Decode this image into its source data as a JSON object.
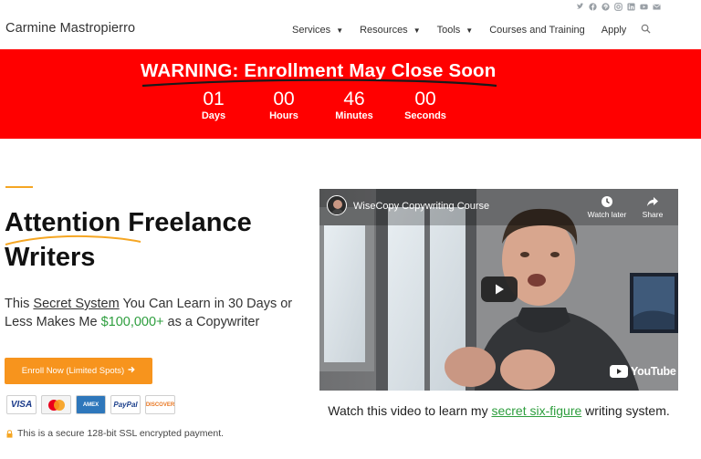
{
  "header": {
    "brand": "Carmine Mastropierro",
    "social_icons": [
      "twitter-icon",
      "facebook-icon",
      "pinterest-icon",
      "instagram-icon",
      "linkedin-icon",
      "youtube-icon",
      "email-icon"
    ],
    "nav": [
      {
        "label": "Services",
        "has_dropdown": true
      },
      {
        "label": "Resources",
        "has_dropdown": true
      },
      {
        "label": "Tools",
        "has_dropdown": true
      },
      {
        "label": "Courses and Training",
        "has_dropdown": false
      },
      {
        "label": "Apply",
        "has_dropdown": false
      }
    ]
  },
  "banner": {
    "title": "WARNING: Enrollment May Close Soon",
    "background": "#ff0000",
    "countdown": [
      {
        "value": "01",
        "label": "Days"
      },
      {
        "value": "00",
        "label": "Hours"
      },
      {
        "value": "46",
        "label": "Minutes"
      },
      {
        "value": "00",
        "label": "Seconds"
      }
    ]
  },
  "hero": {
    "headline_line1": "Attention Freelance",
    "headline_line2": "Writers",
    "sub_pre": "This ",
    "sub_link": "Secret System",
    "sub_mid": " You Can Learn in 30 Days or Less Makes Me ",
    "sub_money": "$100,000+",
    "sub_post": " as a Copywriter",
    "enroll_label": "Enroll Now (Limited Spots)",
    "cards": [
      "VISA",
      "MasterCard",
      "AMERICAN EXPRESS",
      "PayPal",
      "DISCOVER"
    ],
    "secure_text": "This is a secure 128-bit SSL encrypted payment.",
    "accent": "#f7941d"
  },
  "video": {
    "title": "WiseCopy Copywriting Course",
    "watch_later": "Watch later",
    "share": "Share",
    "youtube": "YouTube",
    "caption_pre": "Watch this video to learn my ",
    "caption_link": "secret six-figure",
    "caption_post": " writing system."
  }
}
